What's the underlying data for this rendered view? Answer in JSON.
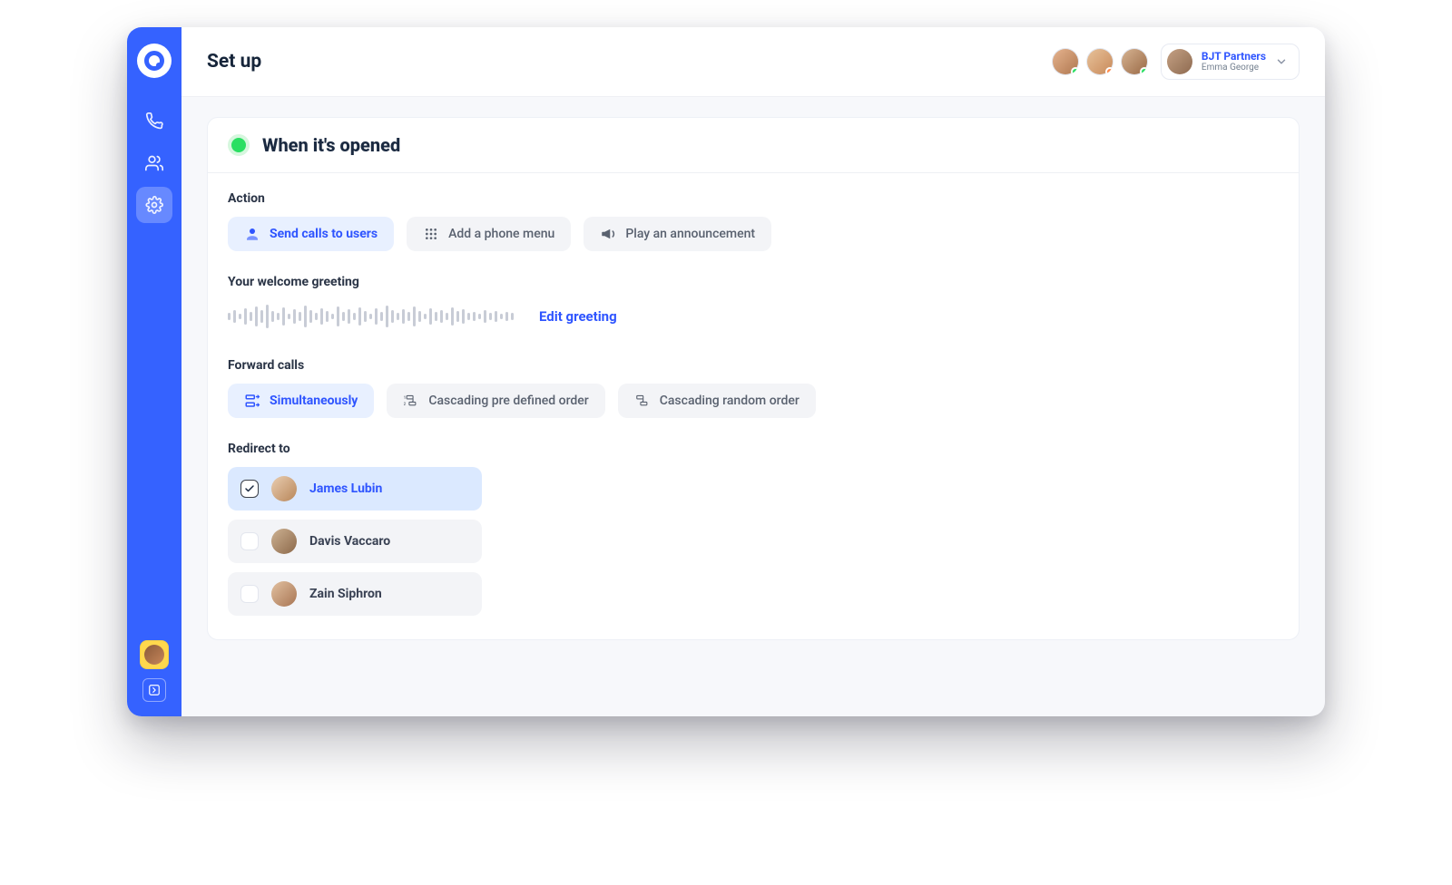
{
  "page": {
    "title": "Set up"
  },
  "account": {
    "org": "BJT Partners",
    "user": "Emma George"
  },
  "presence": [
    {
      "status": "online",
      "color": "#2adf62"
    },
    {
      "status": "busy",
      "color": "#ff8a4a"
    },
    {
      "status": "online",
      "color": "#2adf62"
    }
  ],
  "card": {
    "title": "When it's opened",
    "status": "open"
  },
  "action": {
    "label": "Action",
    "options": [
      {
        "id": "send-users",
        "label": "Send calls to users",
        "icon": "headset",
        "active": true
      },
      {
        "id": "phone-menu",
        "label": "Add a phone menu",
        "icon": "dialpad",
        "active": false
      },
      {
        "id": "announcement",
        "label": "Play an announcement",
        "icon": "megaphone",
        "active": false
      }
    ]
  },
  "greeting": {
    "label": "Your welcome greeting",
    "edit": "Edit greeting"
  },
  "forward": {
    "label": "Forward calls",
    "options": [
      {
        "id": "simultaneous",
        "label": "Simultaneously",
        "icon": "simul",
        "active": true
      },
      {
        "id": "cascade-defined",
        "label": "Cascading pre defined order",
        "icon": "cascade",
        "active": false
      },
      {
        "id": "cascade-random",
        "label": "Cascading random order",
        "icon": "cascade",
        "active": false
      }
    ]
  },
  "redirect": {
    "label": "Redirect to",
    "people": [
      {
        "id": "james",
        "name": "James Lubin",
        "selected": true
      },
      {
        "id": "davis",
        "name": "Davis Vaccaro",
        "selected": false
      },
      {
        "id": "zain",
        "name": "Zain Siphron",
        "selected": false
      }
    ]
  },
  "colors": {
    "primary": "#3562ff",
    "accent": "#2f55ff",
    "success": "#2adf62"
  }
}
